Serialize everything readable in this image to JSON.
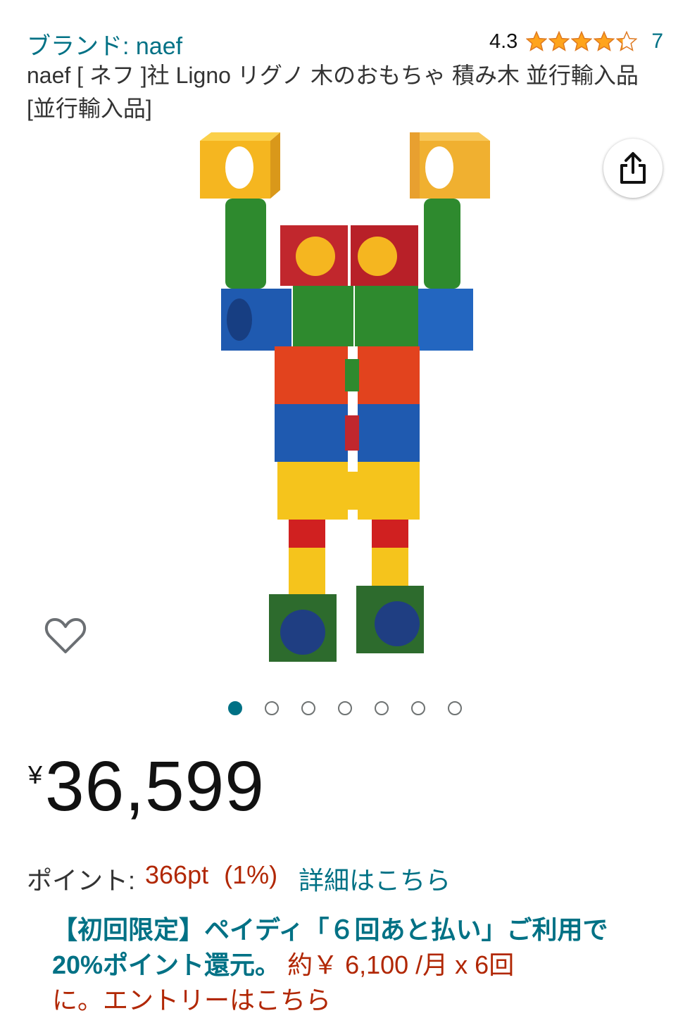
{
  "header": {
    "brand_link": "ブランド: naef",
    "rating_value": "4.3",
    "rating_stars": 4.3,
    "rating_count": "7"
  },
  "product": {
    "title": "naef [ ネフ ]社 Ligno リグノ 木のおもちゃ 積み木 並行輸入品 [並行輸入品]"
  },
  "icons": {
    "share": "share-icon",
    "favorite": "heart-icon",
    "star": "star-icon"
  },
  "carousel": {
    "total": 7,
    "active_index": 0
  },
  "price": {
    "currency_symbol": "¥",
    "amount": "36,599"
  },
  "points": {
    "label": "ポイント:",
    "value": "366pt",
    "percent": "(1%)",
    "detail_link": "詳細はこちら"
  },
  "promo": {
    "headline": "【初回限定】ペイディ「６回あと払い」ご利用で20%ポイント還元。",
    "monthly": "約￥ 6,100 /月 x 6回",
    "entry": "に。エントリーはこちら"
  },
  "colors": {
    "link": "#007185",
    "price_red": "#B12704",
    "star": "#FFA41C"
  }
}
